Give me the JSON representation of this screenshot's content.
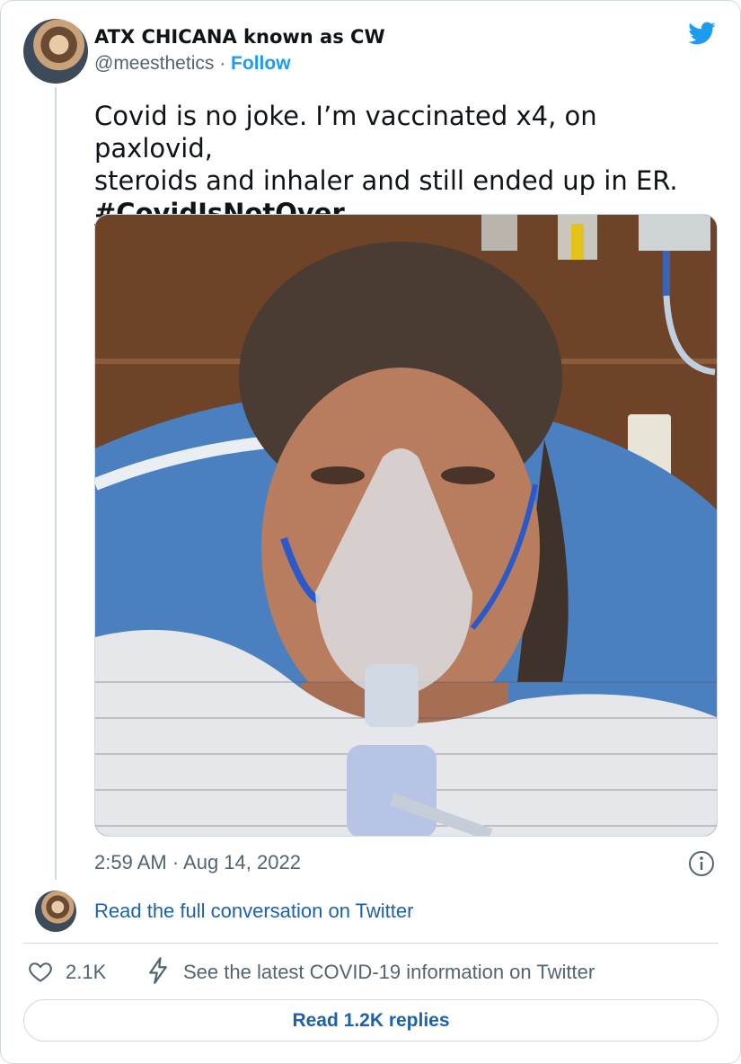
{
  "author": {
    "display_name": "ATX CHICANA known as CW",
    "handle": "@meesthetics",
    "separator": " · ",
    "follow_label": "Follow"
  },
  "tweet": {
    "text_line1": "Covid is no joke. I’m vaccinated x4, on paxlovid,",
    "text_line2": "steroids and inhaler and still ended up in ER.",
    "hashtag": "#CovidIsNotOver",
    "timestamp": "2:59 AM · Aug 14, 2022"
  },
  "conversation": {
    "link_label": "Read the full conversation on Twitter"
  },
  "actions": {
    "like_count": "2.1K",
    "covid_info_label": "See the latest COVID-19 information on Twitter",
    "read_replies_label": "Read 1.2K replies"
  },
  "icons": {
    "brand": "twitter-bird-icon",
    "info": "info-icon",
    "like": "heart-icon",
    "covid": "lightning-bolt-icon"
  },
  "colors": {
    "brand_blue": "#1d9bf0",
    "link_blue": "#1d62a8",
    "muted_text": "#536471",
    "border": "#cfd9de"
  }
}
